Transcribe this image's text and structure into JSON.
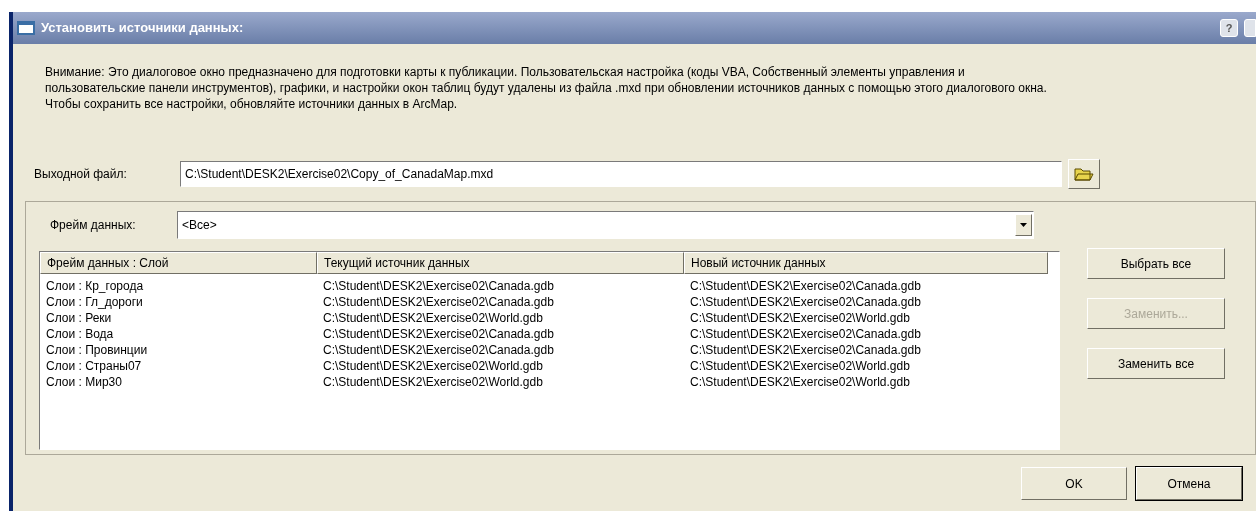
{
  "window": {
    "title": "Установить источники данных:",
    "title_buttons": [
      "?"
    ]
  },
  "notice": "Внимание: Это диалоговое окно предназначено для подготовки карты к публикации. Пользовательская настройка (коды VBA, Собственный элементы управления и пользовательские панели инструментов), графики, и настройки окон таблиц будут удалены из файла .mxd при обновлении источников данных с помощью этого диалогового окна. Чтобы сохранить все настройки, обновляйте источники данных в ArcMap.",
  "output_file": {
    "label": "Выходной файл:",
    "value": "C:\\Student\\DESK2\\Exercise02\\Copy_of_CanadaMap.mxd"
  },
  "data_frame": {
    "label": "Фрейм данных:",
    "value": "<Все>"
  },
  "table": {
    "columns": [
      "Фрейм данных : Слой",
      "Текущий источник данных",
      "Новый источник данных"
    ],
    "rows": [
      [
        "Слои : Кр_города",
        "C:\\Student\\DESK2\\Exercise02\\Canada.gdb",
        "C:\\Student\\DESK2\\Exercise02\\Canada.gdb"
      ],
      [
        "Слои : Гл_дороги",
        "C:\\Student\\DESK2\\Exercise02\\Canada.gdb",
        "C:\\Student\\DESK2\\Exercise02\\Canada.gdb"
      ],
      [
        "Слои : Реки",
        "C:\\Student\\DESK2\\Exercise02\\World.gdb",
        "C:\\Student\\DESK2\\Exercise02\\World.gdb"
      ],
      [
        "Слои : Вода",
        "C:\\Student\\DESK2\\Exercise02\\Canada.gdb",
        "C:\\Student\\DESK2\\Exercise02\\Canada.gdb"
      ],
      [
        "Слои : Провинции",
        "C:\\Student\\DESK2\\Exercise02\\Canada.gdb",
        "C:\\Student\\DESK2\\Exercise02\\Canada.gdb"
      ],
      [
        "Слои : Страны07",
        "C:\\Student\\DESK2\\Exercise02\\World.gdb",
        "C:\\Student\\DESK2\\Exercise02\\World.gdb"
      ],
      [
        "Слои : Мир30",
        "C:\\Student\\DESK2\\Exercise02\\World.gdb",
        "C:\\Student\\DESK2\\Exercise02\\World.gdb"
      ]
    ]
  },
  "side_buttons": [
    {
      "label": "Выбрать все",
      "disabled": false
    },
    {
      "label": "Заменить...",
      "disabled": true
    },
    {
      "label": "Заменить все",
      "disabled": false
    }
  ],
  "footer_buttons": [
    {
      "label": "OK",
      "default": false
    },
    {
      "label": "Отмена",
      "default": true
    }
  ]
}
